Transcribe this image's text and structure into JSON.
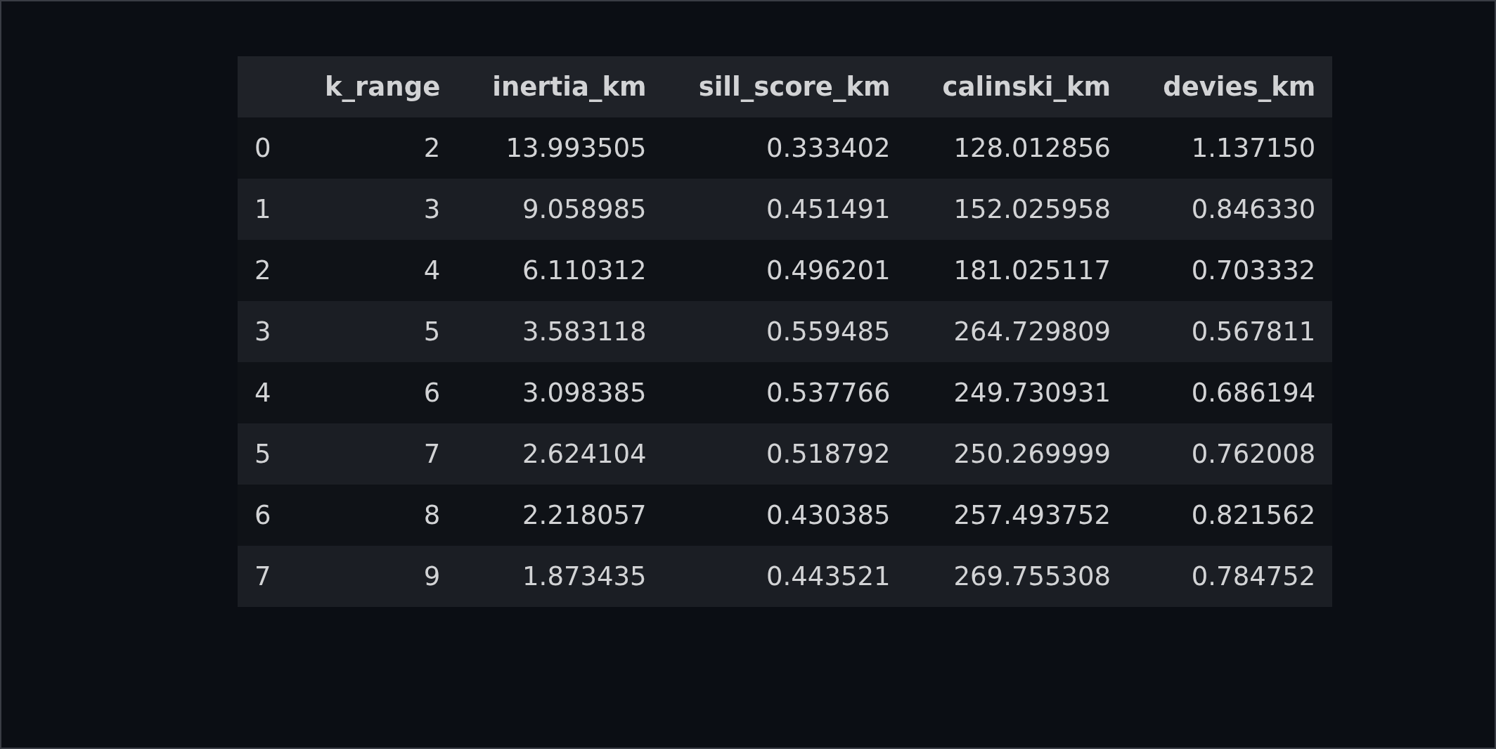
{
  "table": {
    "columns": [
      "",
      "k_range",
      "inertia_km",
      "sill_score_km",
      "calinski_km",
      "devies_km"
    ],
    "rows": [
      [
        "0",
        "2",
        "13.993505",
        "0.333402",
        "128.012856",
        "1.137150"
      ],
      [
        "1",
        "3",
        "9.058985",
        "0.451491",
        "152.025958",
        "0.846330"
      ],
      [
        "2",
        "4",
        "6.110312",
        "0.496201",
        "181.025117",
        "0.703332"
      ],
      [
        "3",
        "5",
        "3.583118",
        "0.559485",
        "264.729809",
        "0.567811"
      ],
      [
        "4",
        "6",
        "3.098385",
        "0.537766",
        "249.730931",
        "0.686194"
      ],
      [
        "5",
        "7",
        "2.624104",
        "0.518792",
        "250.269999",
        "0.762008"
      ],
      [
        "6",
        "8",
        "2.218057",
        "0.430385",
        "257.493752",
        "0.821562"
      ],
      [
        "7",
        "9",
        "1.873435",
        "0.443521",
        "269.755308",
        "0.784752"
      ]
    ]
  }
}
